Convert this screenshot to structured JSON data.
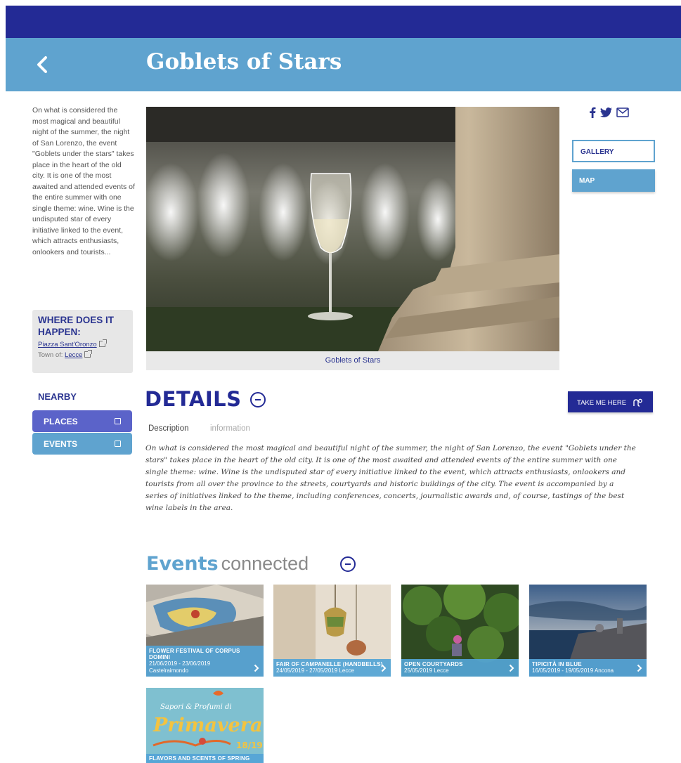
{
  "header": {
    "title": "Goblets of Stars",
    "background_color": "#5fa3cf",
    "topbar_color": "#232a95"
  },
  "intro_text": "On what is considered the most magical and beautiful night of the summer, the night of San Lorenzo, the event \"Goblets under the stars\" takes place in the heart of the old city. It is one of the most awaited and attended events of the entire summer with one single theme: wine. Wine is the undisputed star of every initiative linked to the event, which attracts enthusiasts, onlookers and tourists...",
  "where": {
    "title": "WHERE DOES IT HAPPEN:",
    "place_link": "Piazza Sant'Oronzo",
    "town_label": "Town of:",
    "town_link": "Lecce"
  },
  "nearby": {
    "label": "NEARBY",
    "places_label": "PLACES",
    "events_label": "EVENTS"
  },
  "hero": {
    "caption": "Goblets of Stars"
  },
  "share": {
    "icons": [
      "facebook-icon",
      "twitter-icon",
      "mail-icon"
    ]
  },
  "side_buttons": {
    "gallery_label": "GALLERY",
    "map_label": "MAP"
  },
  "details": {
    "title": "DETAILS",
    "take_me_label": "TAKE ME HERE",
    "tabs": [
      {
        "label": "Description",
        "active": true
      },
      {
        "label": "information",
        "active": false
      }
    ],
    "description": "On what is considered the most magical and beautiful night of the summer, the night of San Lorenzo, the event \"Goblets under the stars\" takes place in the heart of the old city. It is one of the most awaited and attended events of the entire summer with one single theme: wine. Wine is the undisputed star of every initiative linked to the event, which attracts enthusiasts, onlookers and tourists from all over the province to the streets, courtyards and historic buildings of the city. The event is accompanied by a series of initiatives linked to the theme, including conferences, concerts, journalistic awards and, of course, tastings of the best wine labels in the area."
  },
  "events_connected": {
    "title_bold": "Events",
    "title_light": "connected",
    "cards": [
      {
        "title": "FLOWER FESTIVAL OF CORPUS DOMINI",
        "dates": "21/06/2019 - 23/06/2019",
        "place": "Castelraimondo"
      },
      {
        "title": "FAIR OF CAMPANELLE (HANDBELLS)",
        "dates": "24/05/2019 - 27/05/2019",
        "place": "Lecce"
      },
      {
        "title": "OPEN COURTYARDS",
        "dates": "25/05/2019",
        "place": "Lecce"
      },
      {
        "title": "TIPICITÀ IN BLUE",
        "dates": "16/05/2019 - 19/05/2019",
        "place": "Ancona"
      },
      {
        "title": "FLAVORS AND SCENTS OF SPRING",
        "dates": "",
        "place": "",
        "image_text_line1": "Sapori & Profumi di",
        "image_text_line2": "Primavera",
        "image_text_line3": "18/19"
      }
    ]
  }
}
